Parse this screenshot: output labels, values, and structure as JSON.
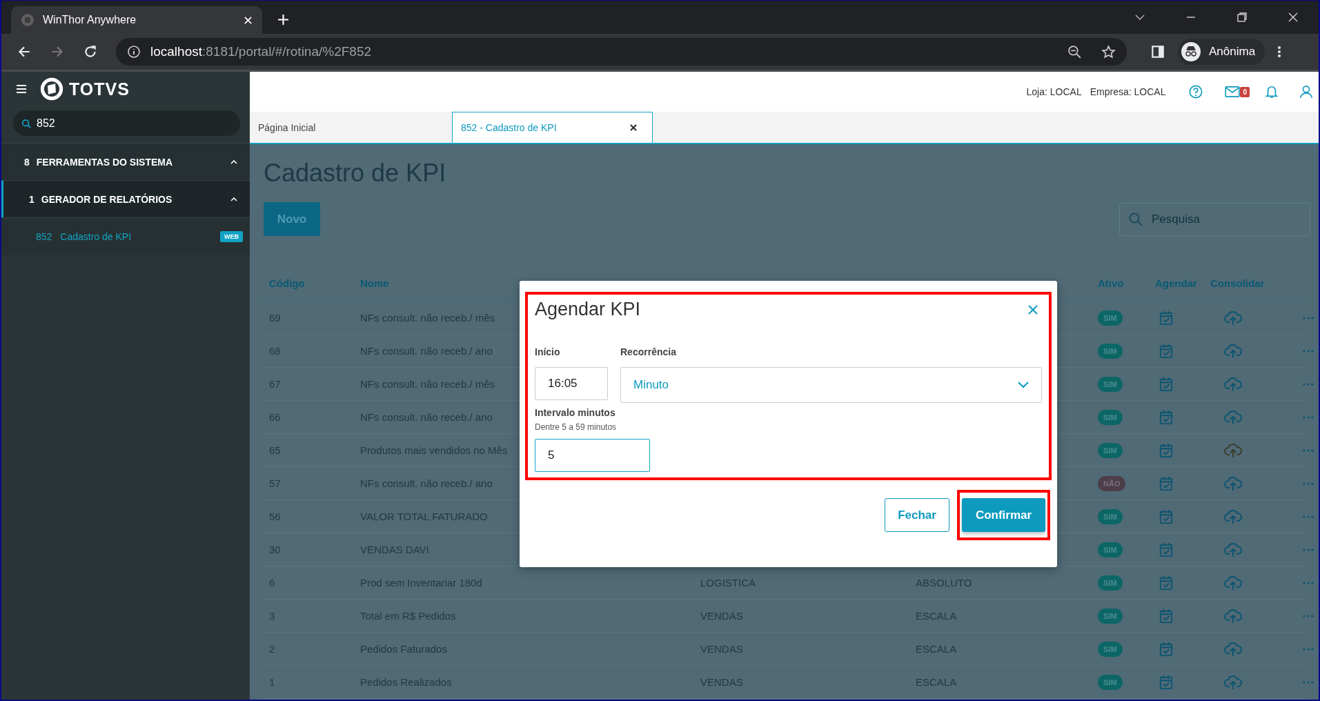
{
  "browser": {
    "tab_title": "WinThor Anywhere",
    "url_host": "localhost",
    "url_path": ":8181/portal/#/rotina/%2F852",
    "profile": "Anônima"
  },
  "sidebar": {
    "brand": "TOTVS",
    "search": "852",
    "menu": [
      {
        "number": "8",
        "label": "FERRAMENTAS DO SISTEMA",
        "expanded": true,
        "selected": false,
        "children": [
          {
            "number": "1",
            "label": "GERADOR DE RELATÓRIOS",
            "expanded": true,
            "selected": true,
            "children": [
              {
                "number": "852",
                "label": "Cadastro de KPI",
                "badge": "WEB",
                "selected": true
              }
            ]
          }
        ]
      }
    ]
  },
  "header": {
    "store": "Loja: LOCAL",
    "company": "Empresa: LOCAL",
    "mail_count": "0"
  },
  "tabs": [
    {
      "label": "Página Inicial",
      "selected": false
    },
    {
      "label": "852 - Cadastro de KPI",
      "selected": true
    }
  ],
  "page": {
    "title": "Cadastro de KPI",
    "new_button": "Novo",
    "search_placeholder": "Pesquisa"
  },
  "table": {
    "columns": {
      "code": "Código",
      "name": "Nome",
      "active": "Ativo",
      "schedule": "Agendar",
      "consolidate": "Consolidar"
    },
    "rows": [
      {
        "code": "69",
        "name": "NFs consult. não receb./ mês",
        "active": {
          "label": "SIM",
          "on": true
        },
        "cloud_alert": false
      },
      {
        "code": "68",
        "name": "NFs consult. não receb./ ano",
        "active": {
          "label": "SIM",
          "on": true
        },
        "cloud_alert": false
      },
      {
        "code": "67",
        "name": "NFs consult. não receb./ mês",
        "active": {
          "label": "SIM",
          "on": true
        },
        "cloud_alert": false
      },
      {
        "code": "66",
        "name": "NFs consult. não receb./ ano",
        "active": {
          "label": "SIM",
          "on": true
        },
        "cloud_alert": false
      },
      {
        "code": "65",
        "name": "Produtos mais vendidos no Mês",
        "active": {
          "label": "SIM",
          "on": true
        },
        "cloud_alert": true
      },
      {
        "code": "57",
        "name": "NFs consult. não receb./ ano",
        "active": {
          "label": "NÃO",
          "on": false
        },
        "cloud_alert": false
      },
      {
        "code": "56",
        "name": "VALOR TOTAL FATURADO",
        "active": {
          "label": "SIM",
          "on": true
        },
        "cloud_alert": false
      },
      {
        "code": "30",
        "name": "VENDAS DAVI",
        "active": {
          "label": "SIM",
          "on": true
        },
        "cloud_alert": false
      },
      {
        "code": "6",
        "name": "Prod sem Inventariar 180d",
        "column_3": "LOGISTICA",
        "column_4": "ABSOLUTO",
        "active": {
          "label": "SIM",
          "on": true
        },
        "cloud_alert": false
      },
      {
        "code": "3",
        "name": "Total em R$ Pedidos",
        "column_3": "VENDAS",
        "column_4": "ESCALA",
        "active": {
          "label": "SIM",
          "on": true
        },
        "cloud_alert": false
      },
      {
        "code": "2",
        "name": "Pedidos Faturados",
        "column_3": "VENDAS",
        "column_4": "ESCALA",
        "active": {
          "label": "SIM",
          "on": true
        },
        "cloud_alert": false
      },
      {
        "code": "1",
        "name": "Pedidos Realizados",
        "column_3": "VENDAS",
        "column_4": "ESCALA",
        "active": {
          "label": "SIM",
          "on": true
        },
        "cloud_alert": false
      }
    ]
  },
  "dialog": {
    "title": "Agendar KPI",
    "body_highlighted": true,
    "start": {
      "label": "Início",
      "value": "16:05"
    },
    "recurrence": {
      "label": "Recorrência",
      "value": "Minuto"
    },
    "interval": {
      "label": "Intervalo minutos",
      "hint": "Dentre 5 a 59 minutos",
      "value": "5",
      "focused": true
    },
    "buttons": [
      {
        "label": "Fechar",
        "kind": "secondary",
        "highlighted": false
      },
      {
        "label": "Confirmar",
        "kind": "primary",
        "highlighted": true
      }
    ]
  }
}
